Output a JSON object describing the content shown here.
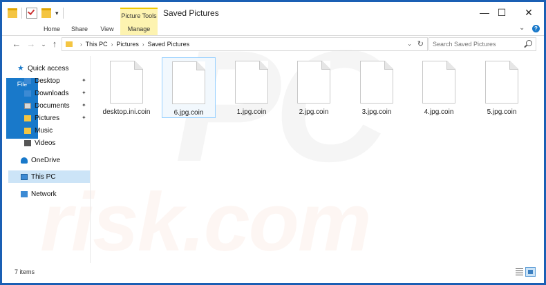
{
  "window": {
    "title": "Saved Pictures",
    "contextual_tab_group": "Picture Tools",
    "controls": {
      "minimize": "—",
      "maximize": "☐",
      "close": "✕"
    }
  },
  "ribbon": {
    "tabs": [
      "File",
      "Home",
      "Share",
      "View",
      "Manage"
    ],
    "expand_icon": "chevron-down",
    "help": "?"
  },
  "navigation": {
    "back": "←",
    "forward": "→",
    "recent_dropdown": "⌄",
    "up": "↑"
  },
  "address_bar": {
    "breadcrumbs": [
      "This PC",
      "Pictures",
      "Saved Pictures"
    ]
  },
  "search": {
    "placeholder": "Search Saved Pictures"
  },
  "sidebar": {
    "items": [
      {
        "label": "Quick access",
        "icon": "star-icon"
      },
      {
        "label": "Desktop",
        "icon": "desktop-icon",
        "pinned": true
      },
      {
        "label": "Downloads",
        "icon": "downloads-icon",
        "pinned": true
      },
      {
        "label": "Documents",
        "icon": "documents-icon",
        "pinned": true
      },
      {
        "label": "Pictures",
        "icon": "pictures-icon",
        "pinned": true
      },
      {
        "label": "Music",
        "icon": "music-icon"
      },
      {
        "label": "Videos",
        "icon": "videos-icon"
      },
      {
        "label": "OneDrive",
        "icon": "cloud-icon"
      },
      {
        "label": "This PC",
        "icon": "computer-icon",
        "selected": true
      },
      {
        "label": "Network",
        "icon": "network-icon"
      }
    ]
  },
  "files": [
    {
      "name": "desktop.ini.coin"
    },
    {
      "name": "6.jpg.coin",
      "selected": true
    },
    {
      "name": "1.jpg.coin"
    },
    {
      "name": "2.jpg.coin"
    },
    {
      "name": "3.jpg.coin"
    },
    {
      "name": "4.jpg.coin"
    },
    {
      "name": "5.jpg.coin"
    }
  ],
  "status": {
    "item_count": "7 items"
  },
  "watermark": {
    "line1": "PC",
    "line2": "risk.com"
  },
  "colors": {
    "accent": "#1979ca",
    "selection": "#cce4f7",
    "contextual": "#fdf3b0"
  }
}
